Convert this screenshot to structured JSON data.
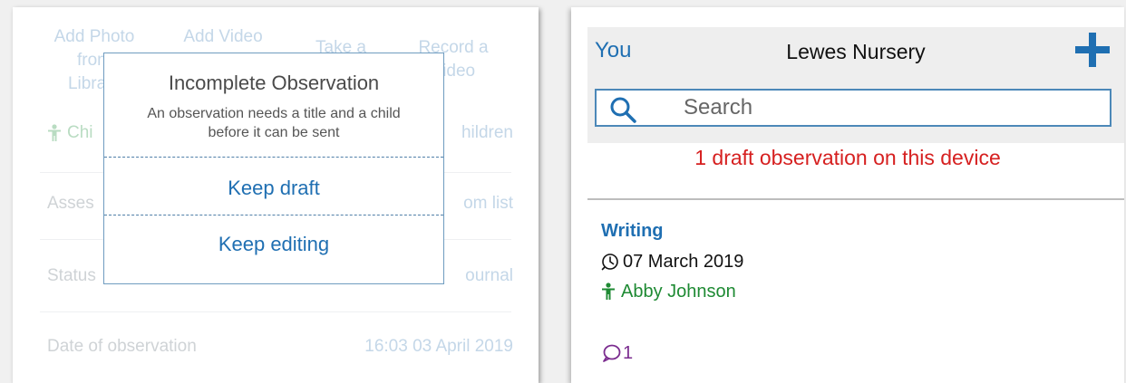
{
  "left_screen": {
    "media_buttons": [
      {
        "line1": "Add Photo",
        "line2": "from",
        "line3": "Library"
      },
      {
        "line1": "Add Video",
        "line2": "",
        "line3": ""
      },
      {
        "line1": "Take a",
        "line2": "",
        "line3": ""
      },
      {
        "line1": "Record a",
        "line2": "Video",
        "line3": ""
      }
    ],
    "children_label": "Chi",
    "children_value": "hildren",
    "assessment_label": "Asses",
    "assessment_value": "om list",
    "status_label": "Status",
    "status_value": "ournal",
    "date_label": "Date of observation",
    "date_value": "16:03 03 April 2019",
    "dialog": {
      "title": "Incomplete Observation",
      "message_line1": "An observation needs a title and a child",
      "message_line2": "before it can be sent",
      "keep_draft": "Keep draft",
      "keep_editing": "Keep editing"
    }
  },
  "right_screen": {
    "nav": {
      "you_label": "You",
      "title": "Lewes Nursery"
    },
    "search": {
      "placeholder": "Search"
    },
    "draft_banner": "1 draft observation on this device",
    "observation": {
      "title": "Writing",
      "date": "07 March 2019",
      "child": "Abby Johnson",
      "comment_count": "1"
    },
    "colors": {
      "accent_blue": "#1f6fb2",
      "banner_red": "#d62020",
      "child_green": "#1e8a33",
      "comment_purple": "#7b2c8f"
    }
  }
}
